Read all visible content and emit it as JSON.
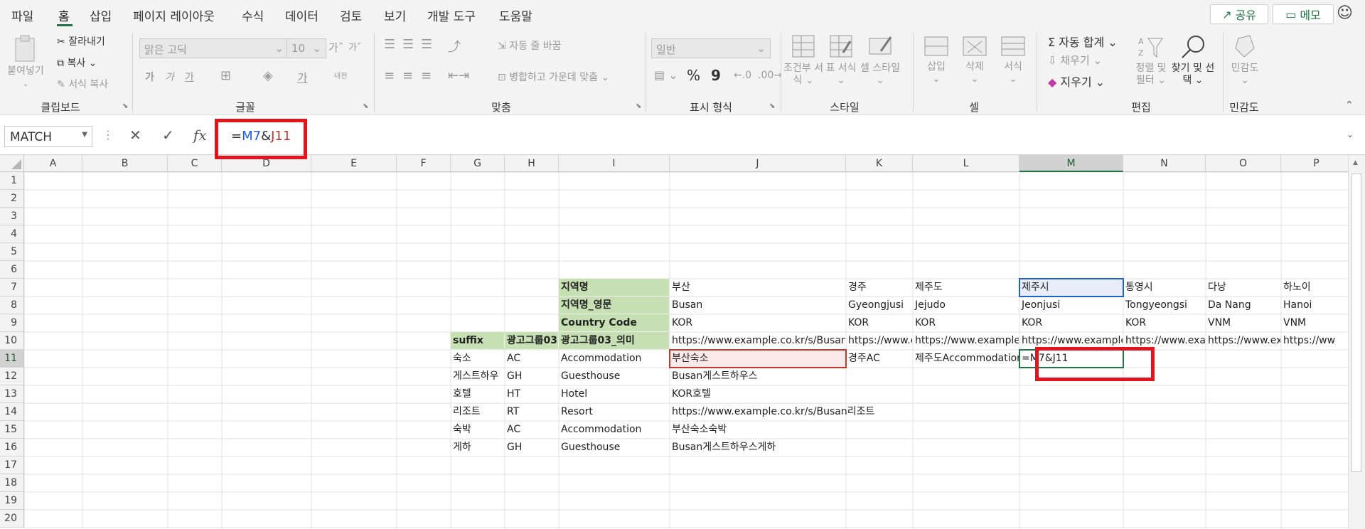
{
  "menu": {
    "tabs": [
      "파일",
      "홈",
      "삽입",
      "페이지 레이아웃",
      "수식",
      "데이터",
      "검토",
      "보기",
      "개발 도구",
      "도움말"
    ],
    "active_tab": "홈",
    "share": "공유",
    "comments": "메모"
  },
  "ribbon": {
    "clipboard": {
      "paste": "붙여넣기",
      "cut": "잘라내기",
      "copy": "복사",
      "format_painter": "서식 복사",
      "label": "클립보드"
    },
    "font": {
      "name": "맑은 고딕",
      "size": "10",
      "label": "글꼴",
      "bold": "가",
      "italic": "가",
      "underline": "가",
      "phonetic": "내천"
    },
    "alignment": {
      "wrap_text": "자동 줄 바꿈",
      "merge_center": "병합하고 가운데 맞춤",
      "label": "맞춤"
    },
    "number": {
      "format": "일반",
      "percent": "%",
      "comma": "9",
      "label": "표시 형식"
    },
    "styles": {
      "conditional": "조건부 서식",
      "table": "표 서식",
      "cell_styles": "셀 스타일",
      "label": "스타일"
    },
    "cells": {
      "insert": "삽입",
      "delete": "삭제",
      "format": "서식",
      "label": "셀"
    },
    "editing": {
      "autosum": "자동 합계",
      "fill": "채우기",
      "clear": "지우기",
      "sort_filter": "정렬 및 필터",
      "find_select": "찾기 및 선택",
      "label": "편집"
    },
    "sensitivity": {
      "label_btn": "민감도",
      "label": "민감도"
    }
  },
  "formula_bar": {
    "name_box": "MATCH",
    "formula_prefix": "=",
    "formula_ref1": "M7",
    "formula_amp": "&",
    "formula_ref2": "J11",
    "fx": "fx"
  },
  "sheet": {
    "columns": [
      "A",
      "B",
      "C",
      "D",
      "E",
      "F",
      "G",
      "H",
      "I",
      "J",
      "K",
      "L",
      "M",
      "N",
      "O",
      "P"
    ],
    "rows": [
      "1",
      "2",
      "3",
      "4",
      "5",
      "6",
      "7",
      "8",
      "9",
      "10",
      "11",
      "12",
      "13",
      "14",
      "15",
      "16",
      "17",
      "18",
      "19",
      "20"
    ],
    "active_column": "M",
    "active_row": "11",
    "cells": {
      "I7": "지역명",
      "J7": "부산",
      "K7": "경주",
      "L7": "제주도",
      "M7": "제주시",
      "N7": "통영시",
      "O7": "다낭",
      "P7": "하노이",
      "I8": "지역명_영문",
      "J8": "Busan",
      "K8": "Gyeongjusi",
      "L8": "Jejudo",
      "M8": "Jeonjusi",
      "N8": "Tongyeongsi",
      "O8": "Da Nang",
      "P8": "Hanoi",
      "I9": "Country Code",
      "J9": "KOR",
      "K9": "KOR",
      "L9": "KOR",
      "M9": "KOR",
      "N9": "KOR",
      "O9": "VNM",
      "P9": "VNM",
      "G10": "suffix",
      "H10": "광고그룹03",
      "I10": "광고그룹03_의미",
      "J10": "https://www.example.co.kr/s/Busan",
      "K10": "https://www.ex",
      "L10": "https://www.example.co",
      "M10": "https://www.example.c",
      "N10": "https://www.exam",
      "O10": "https://www.exa",
      "P10": "https://ww",
      "G11": "숙소",
      "H11": "AC",
      "I11": "Accommodation",
      "J11": "부산숙소",
      "K11": "경주AC",
      "L11": "제주도Accommodation",
      "M11": "=M7&J11",
      "G12": "게스트하우",
      "H12": "GH",
      "I12": "Guesthouse",
      "J12": "Busan게스트하우스",
      "G13": "호텔",
      "H13": "HT",
      "I13": "Hotel",
      "J13": "KOR호텔",
      "G14": "리조트",
      "H14": "RT",
      "I14": "Resort",
      "J14": "https://www.example.co.kr/s/Busan리조트",
      "G15": "숙박",
      "H15": "AC",
      "I15": "Accommodation",
      "J15": "부산숙소숙박",
      "G16": "게하",
      "H16": "GH",
      "I16": "Guesthouse",
      "J16": "Busan게스트하우스게하"
    }
  },
  "colors": {
    "excel_green": "#217346",
    "header_green": "#c6e0b4",
    "ref_blue": "#1f5fd1",
    "ref_red": "#c0392b",
    "annotation_red": "#e3141b"
  }
}
